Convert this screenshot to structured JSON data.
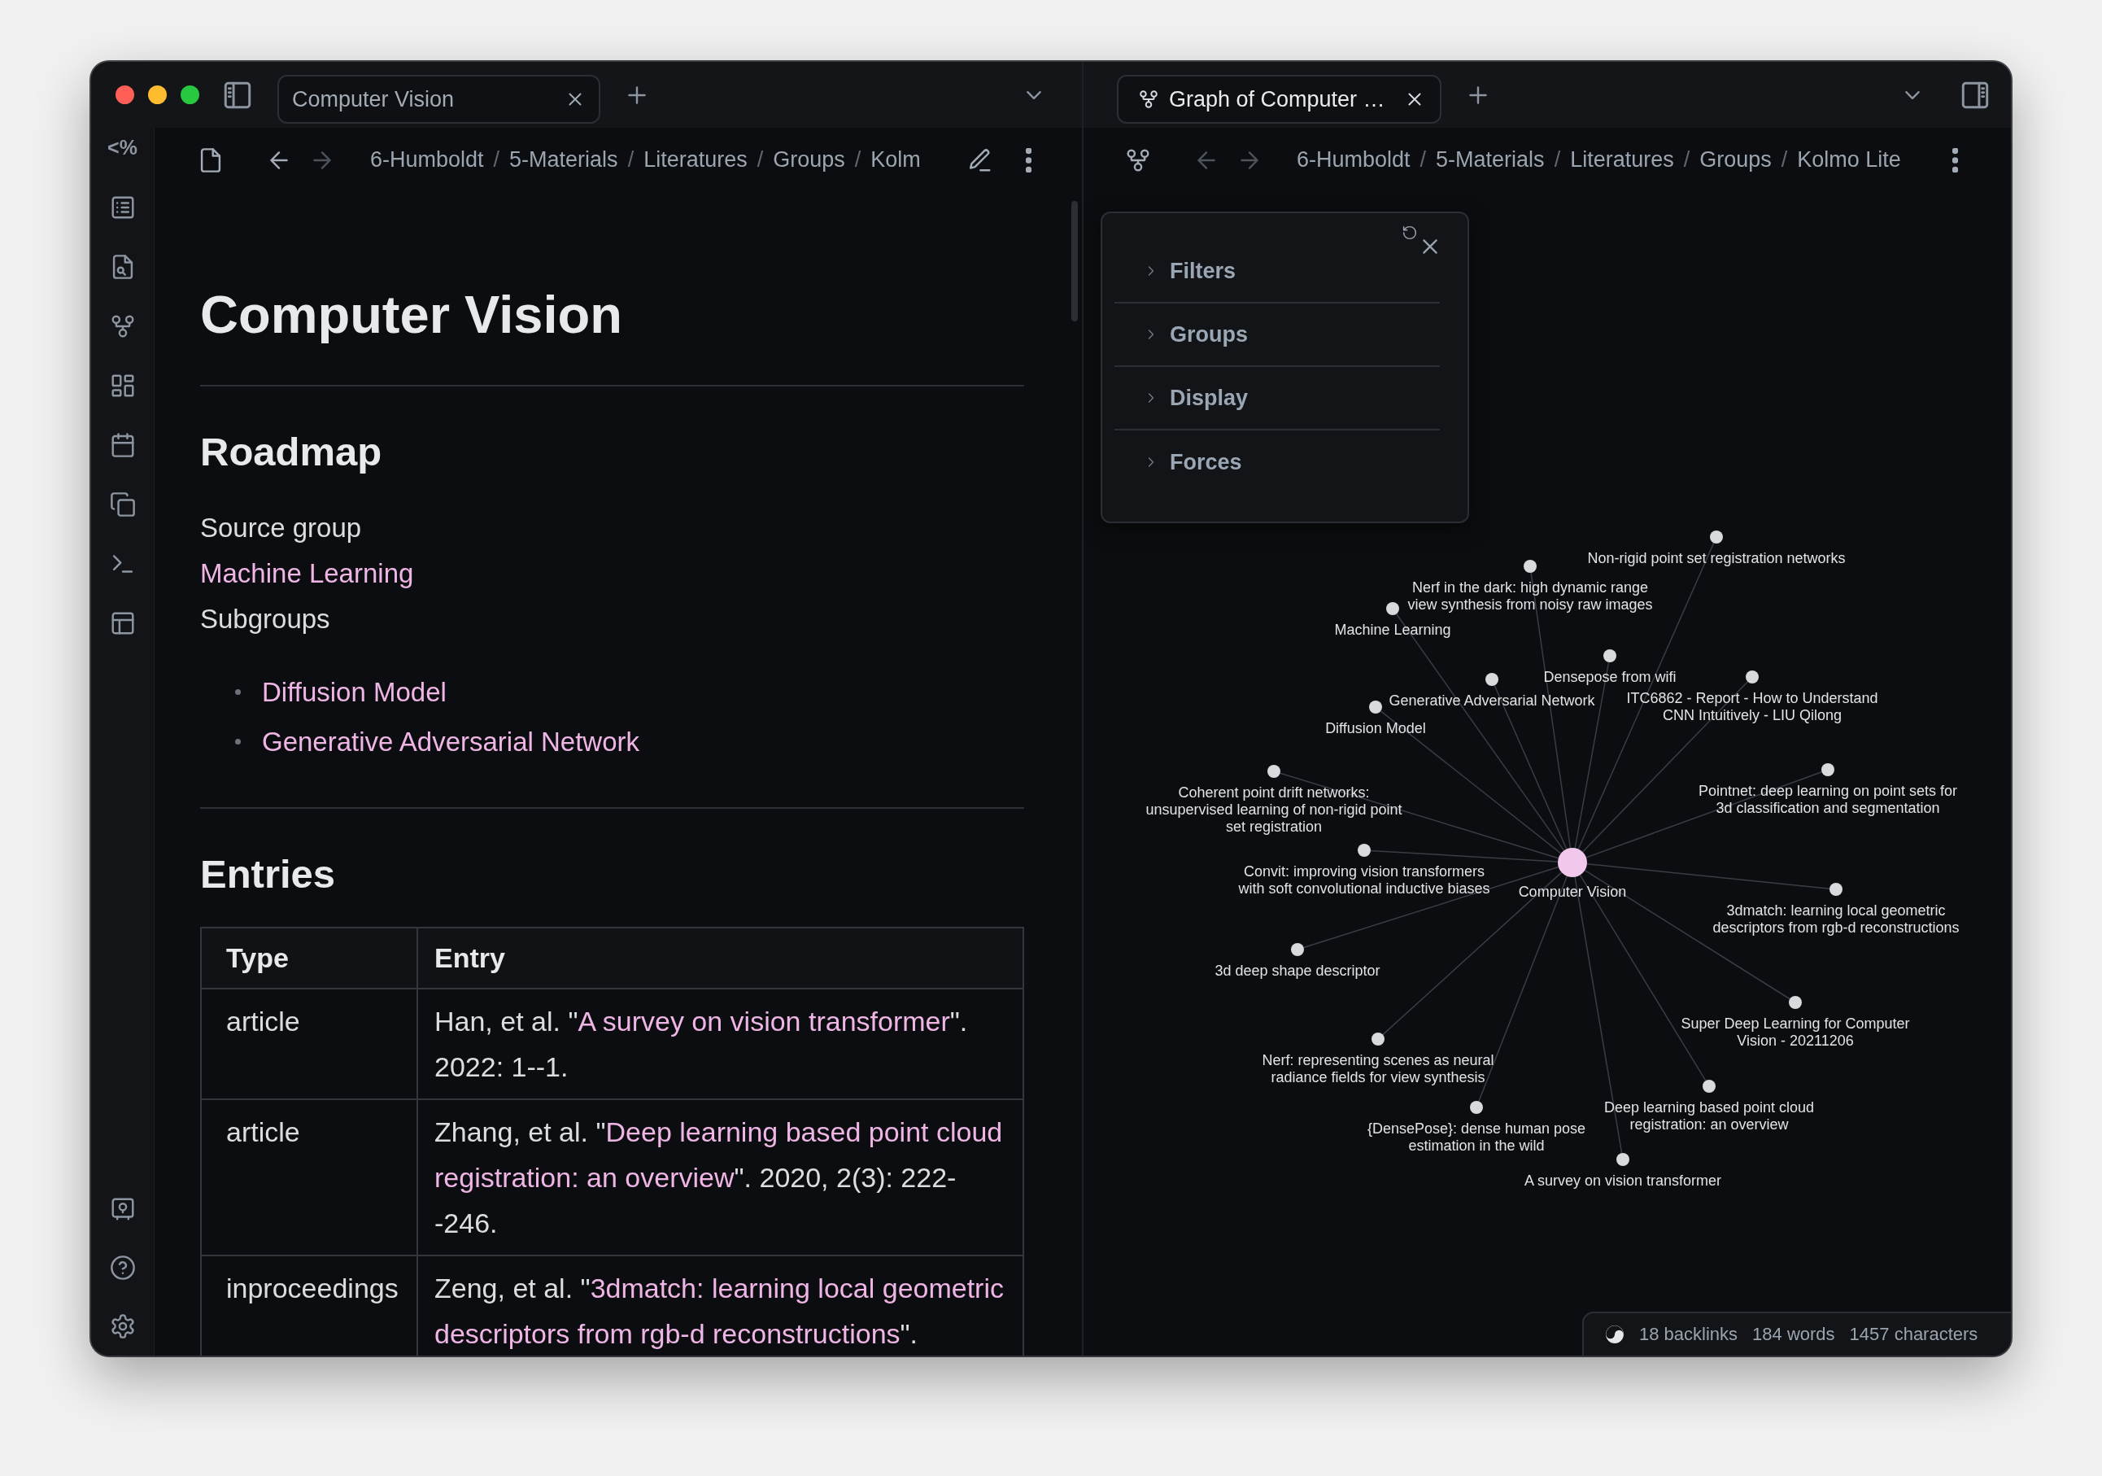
{
  "ribbon": {
    "glyph": "<%"
  },
  "left_pane": {
    "focused": false,
    "tab": {
      "title": "Computer Vision",
      "selected": true
    },
    "nav": {
      "back": {
        "disabled": false
      },
      "forward": {
        "disabled": true
      }
    },
    "breadcrumb": {
      "separator": "/",
      "items": [
        "6-Humboldt",
        "5-Materials",
        "Literatures",
        "Groups",
        "Kolm"
      ]
    },
    "note": {
      "title": "Computer Vision",
      "roadmap": {
        "heading": "Roadmap",
        "lines": [
          {
            "kind": "text",
            "text": "Source group"
          },
          {
            "kind": "link",
            "text": "Machine Learning"
          },
          {
            "kind": "text",
            "text": "Subgroups"
          }
        ],
        "bullets": [
          {
            "text": "Diffusion Model"
          },
          {
            "text": "Generative Adversarial Network"
          }
        ]
      },
      "entries": {
        "heading": "Entries",
        "table": {
          "columns": [
            "Type",
            "Entry"
          ],
          "rows": [
            {
              "type": "article",
              "entry": {
                "before": "Han, et al. \"",
                "link_lines": [
                  "A survey on vision transformer"
                ],
                "after": "\". 2022: 1--1."
              }
            },
            {
              "type": "article",
              "entry": {
                "before": "Zhang, et al. \"",
                "link_lines": [
                  "Deep learning based point cloud",
                  "registration: an overview"
                ],
                "after": "\". 2020, 2(3): 222--246."
              }
            },
            {
              "type": "inproceedings",
              "entry": {
                "before": "Zeng, et al. \"",
                "link_lines": [
                  "3dmatch: learning local geometric",
                  "descriptors from rgb-d reconstructions"
                ],
                "after": "\"."
              }
            }
          ]
        }
      }
    }
  },
  "right_pane": {
    "focused": true,
    "tab": {
      "title": "Graph of Computer …",
      "selected": true
    },
    "nav": {
      "back": {
        "disabled": true
      },
      "forward": {
        "disabled": true
      }
    },
    "breadcrumb": {
      "separator": "/",
      "items": [
        "6-Humboldt",
        "5-Materials",
        "Literatures",
        "Groups",
        "Kolmo Lite"
      ]
    },
    "graph_controls": {
      "sections": [
        {
          "label": "Filters",
          "expanded": false
        },
        {
          "label": "Groups",
          "expanded": false
        },
        {
          "label": "Display",
          "expanded": false
        },
        {
          "label": "Forces",
          "expanded": false
        }
      ]
    },
    "graph": {
      "center": {
        "label": "Computer Vision"
      },
      "nodes": [
        {
          "label": "Non-rigid point set registration networks"
        },
        {
          "label": "Nerf in the dark: high dynamic range\nview synthesis from noisy raw images"
        },
        {
          "label": "Machine Learning"
        },
        {
          "label": "Densepose from wifi"
        },
        {
          "label": "Generative Adversarial Network"
        },
        {
          "label": "ITC6862 - Report - How to Understand\nCNN Intuitively - LIU Qilong"
        },
        {
          "label": "Diffusion Model"
        },
        {
          "label": "Coherent point drift networks:\nunsupervised learning of non-rigid point\nset registration"
        },
        {
          "label": "Pointnet: deep learning on point sets for\n3d classification and segmentation"
        },
        {
          "label": "Convit: improving vision transformers\nwith soft convolutional inductive biases"
        },
        {
          "label": "3dmatch: learning local geometric\ndescriptors from rgb-d reconstructions"
        },
        {
          "label": "3d deep shape descriptor"
        },
        {
          "label": "Super Deep Learning for Computer\nVision - 20211206"
        },
        {
          "label": "Nerf: representing scenes as neural\nradiance fields for view synthesis"
        },
        {
          "label": "Deep learning based point cloud\nregistration: an overview"
        },
        {
          "label": "{DensePose}: dense human pose\nestimation in the wild"
        },
        {
          "label": "A survey on vision transformer"
        }
      ]
    }
  },
  "status_bar": {
    "items": [
      "18 backlinks",
      "184 words",
      "1457 characters"
    ]
  }
}
